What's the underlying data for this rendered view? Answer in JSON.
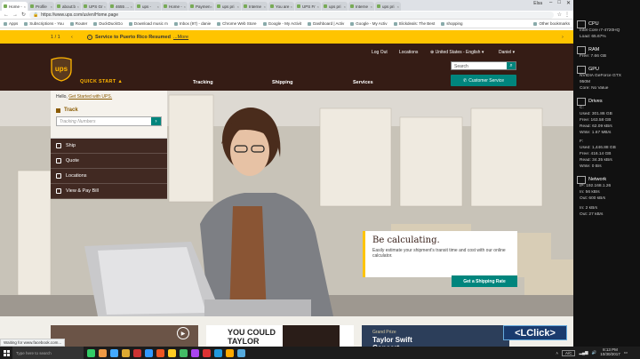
{
  "browser": {
    "tabs": [
      "Home -",
      "Profile",
      "about:b",
      "UPS Gr",
      "4655 ...",
      "ups -",
      "Home -",
      "Paymen",
      "ups pri",
      "Interne",
      "You are",
      "UPS Fr",
      "ups pri",
      "Interne",
      "ups pri"
    ],
    "active_tab": 0,
    "user": "Elsa",
    "url_prefix": "Untitled ... ce 1 (ID)",
    "url": "https://www.ups.com/us/en/Home.page",
    "bookmarks": [
      "Apps",
      "Subscriptions - You",
      "Router",
      "DuckDuckGo",
      "Download music m",
      "Inbox (97) - danie",
      "Chrome Web Store",
      "Google - My Activit",
      "Dashboard | Activ",
      "Google - My Activ",
      "Slickdeals: The Best",
      "shopping"
    ],
    "other_bookmarks": "Other bookmarks",
    "status_text": "Waiting for www.facebook.com..."
  },
  "ups": {
    "alert_pager": "1 / 1",
    "alert_prev": "‹",
    "alert_next": "›",
    "alert_icon": "i",
    "alert_bold": "Service to Puerto Rico Resumed",
    "alert_more": "...More",
    "logo_text": "ups",
    "quick_start": "QUICK START",
    "quick_start_arrow": "▲",
    "utility": {
      "logout": "Log Out",
      "locations": "Locations",
      "language": "United States - English",
      "user": "Daniel"
    },
    "search_placeholder": "Search",
    "search_icon": "⌕",
    "nav": {
      "tracking": "Tracking",
      "shipping": "Shipping",
      "services": "Services"
    },
    "customer_service": "Customer Service",
    "hello_prefix": "Hello,",
    "hello_link": "Get Started with UPS.",
    "track_label": "Track",
    "track_placeholder": "Tracking Numbers",
    "track_go": "›",
    "menu": [
      "Ship",
      "Quote",
      "Locations",
      "View & Pay Bill"
    ],
    "promo_title": "Be calculating.",
    "promo_text": "Easily estimate your shipment's transit time and cost with our online calculator.",
    "promo_button": "Get a Shipping Rate",
    "card2_text": "YOU COULD\nTAYLOR\nCONCERT",
    "card3_sub": "Grand Prize",
    "card3_title": "Taylor Swift\nConcert",
    "play_icon": "▶",
    "watermark": "<LClick>"
  },
  "sidebar": {
    "sections": [
      {
        "title": "CPU",
        "lines": [
          "Intel Core i7-4720HQ",
          "Load: 65.67%"
        ]
      },
      {
        "title": "RAM",
        "lines": [
          "Free: 7.66 GB"
        ]
      },
      {
        "title": "GPU",
        "lines": [
          "NVIDIA GeForce GTX",
          "950M",
          "Core: No Value"
        ]
      },
      {
        "title": "Drives",
        "lines": [
          "C:",
          "Used: 301.86 GB",
          "Free: 163.58 GB",
          "Read: 62.09 kB/s",
          "Write: 1.67 MB/s",
          "",
          "F:",
          "Used: 1,446.88 GB",
          "Free: 416.14 GB",
          "Read: 34.35 kB/s",
          "Write: 0 B/s"
        ]
      },
      {
        "title": "Network",
        "lines": [
          "IP: 192.168.1.26",
          "In: 56 kB/s",
          "Out: 600 kB/s",
          "",
          "In: 2 kB/s",
          "Out: 27 kB/s"
        ]
      }
    ]
  },
  "taskbar": {
    "search": "Type here to search",
    "keyboard": "A/C",
    "time": "8:13 PM",
    "date": "10/30/2017",
    "app_colors": [
      "#3c6",
      "#e94",
      "#4af",
      "#da3",
      "#c33",
      "#39f",
      "#e52",
      "#fc2",
      "#4b6",
      "#a4e",
      "#d33",
      "#29d",
      "#fa0",
      "#5ad"
    ]
  },
  "colors": {
    "ups_brown": "#351c15",
    "ups_gold": "#ffc400",
    "ups_teal": "#00857d"
  }
}
